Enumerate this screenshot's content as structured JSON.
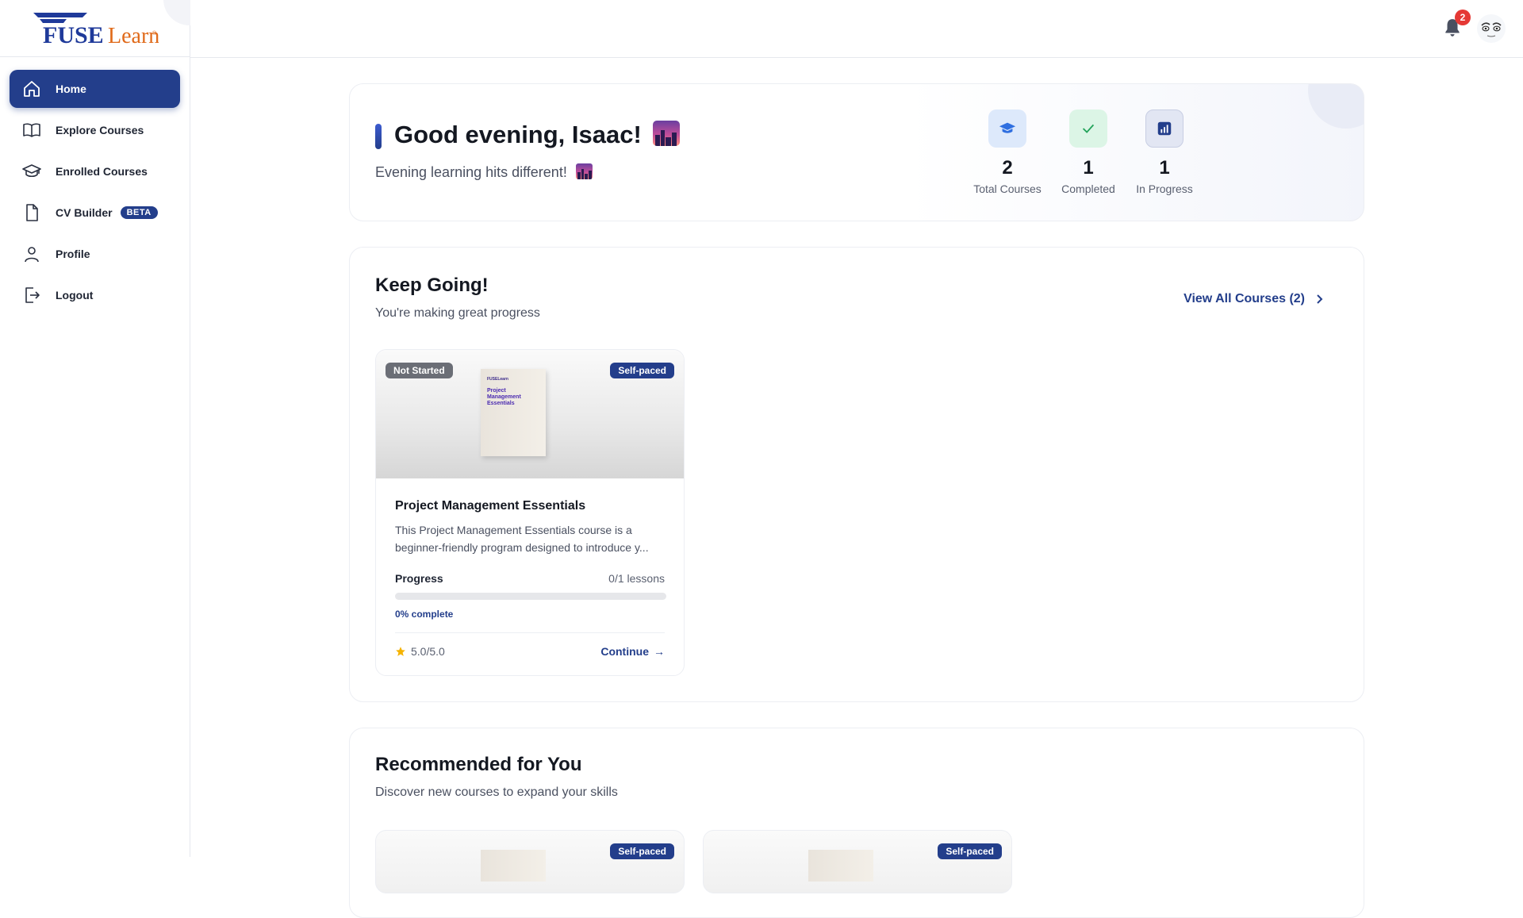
{
  "brand": {
    "name": "FUSELearn"
  },
  "sidebar": {
    "items": [
      {
        "label": "Home",
        "icon": "home-icon",
        "active": true
      },
      {
        "label": "Explore Courses",
        "icon": "book-open-icon"
      },
      {
        "label": "Enrolled Courses",
        "icon": "graduation-cap-icon"
      },
      {
        "label": "CV Builder",
        "icon": "document-icon",
        "badge": "BETA"
      },
      {
        "label": "Profile",
        "icon": "user-icon"
      },
      {
        "label": "Logout",
        "icon": "logout-icon"
      }
    ]
  },
  "topbar": {
    "notifications_count": "2"
  },
  "welcome": {
    "greeting": "Good evening, Isaac!",
    "subtitle": "Evening learning hits different!",
    "stats": [
      {
        "value": "2",
        "label": "Total Courses",
        "icon": "graduation-cap-icon",
        "color": "#2f6fe0"
      },
      {
        "value": "1",
        "label": "Completed",
        "icon": "check-icon",
        "color": "#22a35a"
      },
      {
        "value": "1",
        "label": "In Progress",
        "icon": "bar-chart-icon",
        "color": "#233e8b"
      }
    ]
  },
  "keep_going": {
    "title": "Keep Going!",
    "subtitle": "You're making great progress",
    "view_all": "View All Courses (2)",
    "course": {
      "status": "Not Started",
      "pace": "Self-paced",
      "cover_brand": "FUSELearn",
      "cover_title": "Project Management Essentials",
      "title": "Project Management Essentials",
      "description": "This Project Management Essentials course is a beginner-friendly program designed to introduce y...",
      "progress_label": "Progress",
      "progress_value": "0/1 lessons",
      "progress_fraction": 0,
      "percent_text": "0% complete",
      "rating": "5.0/5.0",
      "continue_label": "Continue"
    }
  },
  "recommended": {
    "title": "Recommended for You",
    "subtitle": "Discover new courses to expand your skills",
    "cards": [
      {
        "pace": "Self-paced"
      },
      {
        "pace": "Self-paced"
      }
    ]
  },
  "colors": {
    "primary": "#233e8b",
    "accent_orange": "#e06a1a",
    "danger": "#e53935",
    "star": "#f5b301"
  }
}
